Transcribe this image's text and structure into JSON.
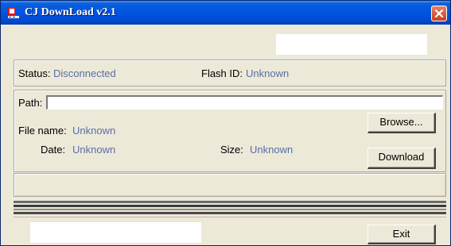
{
  "window": {
    "title": "CJ DownLoad v2.1"
  },
  "status": {
    "status_label": "Status:",
    "status_value": "Disconnected",
    "flash_label": "Flash ID:",
    "flash_value": "Unknown"
  },
  "file": {
    "path_label": "Path:",
    "path_value": "",
    "name_label": "File name:",
    "name_value": "Unknown",
    "date_label": "Date:",
    "date_value": "Unknown",
    "size_label": "Size:",
    "size_value": "Unknown"
  },
  "buttons": {
    "browse": "Browse...",
    "download": "Download",
    "exit": "Exit"
  },
  "colors": {
    "titlebar": "#0054e3",
    "value_text": "#5a6eaa",
    "background": "#ece9d8",
    "close": "#c8401e"
  },
  "icons": {
    "app": "app-icon",
    "close": "close-x-icon"
  }
}
